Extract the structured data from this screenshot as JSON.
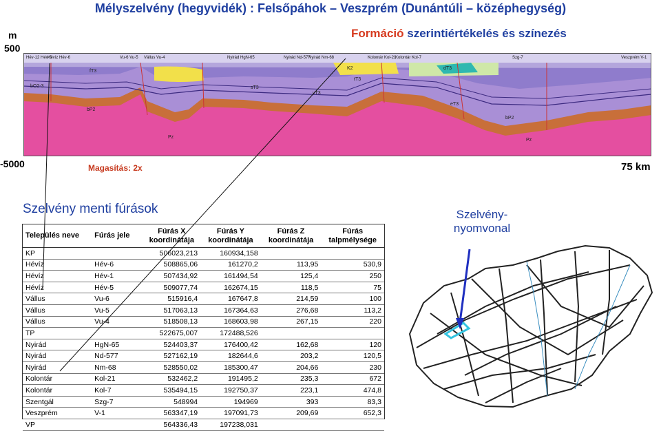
{
  "title": "Mélyszelvény (hegyvidék) : Felsőpáhok – Veszprém (Dunántúli – középhegység)",
  "subtitle": {
    "part1": "Formáció",
    "part2": "szerintiértékelés és színezés"
  },
  "axis": {
    "unit": "m",
    "top": "500",
    "bottom": "-5000",
    "length": "75 km",
    "exaggeration": "Magasítás: 2x"
  },
  "section_labels": {
    "wells": [
      "Hév-12 Hév-5",
      "Hévíz Hév-6",
      "Vu-6 Vu-5",
      "Vállus Vu-4",
      "Nyirád HgN-65",
      "Nyirád Nd-577",
      "Nyirád Nm-68",
      "Kolontár Kol-21",
      "Kolontár Kol-7",
      "Szg-7",
      "Veszprém V-1"
    ],
    "formations": [
      "fT3",
      "bP2",
      "Pz",
      "sT3",
      "vT3",
      "tT3",
      "K2",
      "dT3",
      "eT3",
      "bO2-3"
    ]
  },
  "boreholes_heading": "Szelvény menti fúrások",
  "trace_label": "Szelvény-nyomvonal",
  "table": {
    "headers": [
      "Település neve",
      "Fúrás jele",
      "Fúrás X koordinátája",
      "Fúrás Y koordinátája",
      "Fúrás Z koordinátája",
      "Fúrás talpmélysége"
    ],
    "rows": [
      [
        "KP",
        "",
        "506023,213",
        "160934,158",
        "",
        ""
      ],
      [
        "Hévíz",
        "Hév-6",
        "508865,06",
        "161270,2",
        "113,95",
        "530,9"
      ],
      [
        "Hévíz",
        "Hév-1",
        "507434,92",
        "161494,54",
        "125,4",
        "250"
      ],
      [
        "Hévíz",
        "Hév-5",
        "509077,74",
        "162674,15",
        "118,5",
        "75"
      ],
      [
        "Vállus",
        "Vu-6",
        "515916,4",
        "167647,8",
        "214,59",
        "100"
      ],
      [
        "Vállus",
        "Vu-5",
        "517063,13",
        "167364,63",
        "276,68",
        "113,2"
      ],
      [
        "Vállus",
        "Vu-4",
        "518508,13",
        "168603,98",
        "267,15",
        "220"
      ],
      [
        "TP",
        "",
        "522675,007",
        "172488,526",
        "",
        ""
      ],
      [
        "Nyirád",
        "HgN-65",
        "524403,37",
        "176400,42",
        "162,68",
        "120"
      ],
      [
        "Nyirád",
        "Nd-577",
        "527162,19",
        "182644,6",
        "203,2",
        "120,5"
      ],
      [
        "Nyirád",
        "Nm-68",
        "528550,02",
        "185300,47",
        "204,66",
        "230"
      ],
      [
        "Kolontár",
        "Kol-21",
        "532462,2",
        "191495,2",
        "235,3",
        "672"
      ],
      [
        "Kolontár",
        "Kol-7",
        "535494,15",
        "192750,37",
        "223,1",
        "474,8"
      ],
      [
        "Szentgál",
        "Szg-7",
        "548994",
        "194969",
        "393",
        "83,3"
      ],
      [
        "Veszprém",
        "V-1",
        "563347,19",
        "197091,73",
        "209,69",
        "652,3"
      ],
      [
        "VP",
        "",
        "564336,43",
        "197238,031",
        "",
        ""
      ]
    ]
  },
  "colors": {
    "title": "#1f3fa0",
    "accent": "#d63a1f",
    "basement": "#e44fa0",
    "permian": "#c86f3a",
    "triassic": "#a98fd6",
    "cretaceous": "#f2e04a",
    "cover": "#cfe8a8",
    "trace": "#33c3e0"
  }
}
